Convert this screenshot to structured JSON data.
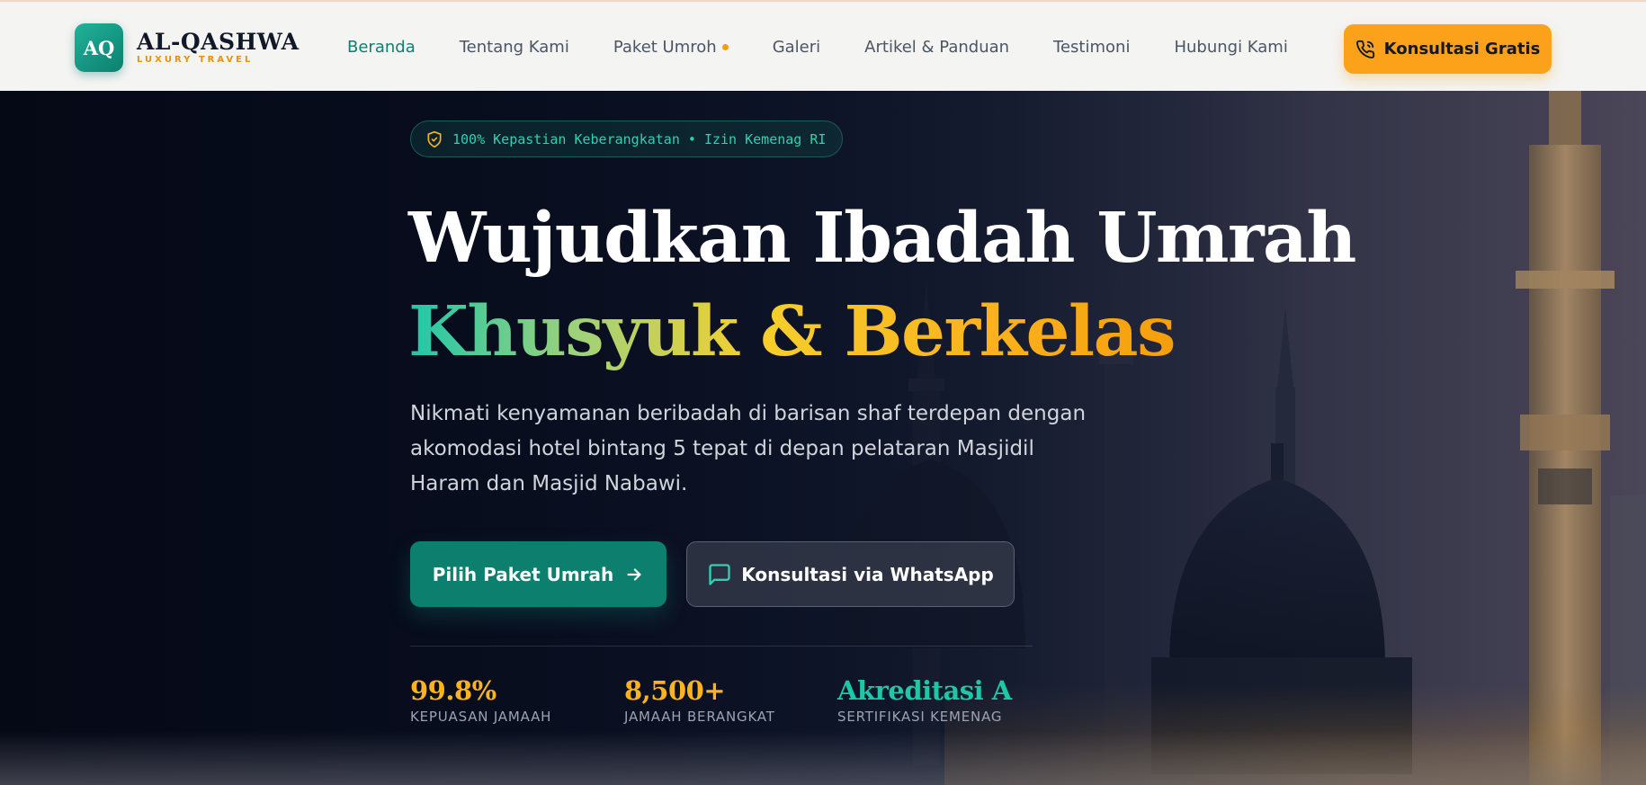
{
  "brand": {
    "badge": "AQ",
    "name": "AL-QASHWA",
    "tagline": "LUXURY TRAVEL"
  },
  "nav": {
    "items": [
      {
        "label": "Beranda",
        "active": true
      },
      {
        "label": "Tentang Kami"
      },
      {
        "label": "Paket Umroh",
        "indicator": true
      },
      {
        "label": "Galeri"
      },
      {
        "label": "Artikel & Panduan"
      },
      {
        "label": "Testimoni"
      },
      {
        "label": "Hubungi Kami"
      }
    ],
    "cta_label": "Konsultasi Gratis"
  },
  "hero": {
    "badge_text": "100% Kepastian Keberangkatan • Izin Kemenag RI",
    "headline_line1": "Wujudkan Ibadah Umrah",
    "headline_line2": "Khusyuk & Berkelas",
    "lead": "Nikmati kenyamanan beribadah di barisan shaf terdepan dengan akomodasi hotel bintang 5 tepat di depan pelataran Masjidil Haram dan Masjid Nabawi.",
    "primary_button": "Pilih Paket Umrah",
    "secondary_button": "Konsultasi via WhatsApp",
    "stats": [
      {
        "value": "99.8%",
        "label": "KEPUASAN JAMAAH",
        "color": "#fbb31e"
      },
      {
        "value": "8,500+",
        "label": "JAMAAH BERANGKAT",
        "color": "#fbb31e"
      },
      {
        "value": "Akreditasi A",
        "label": "SERTIFIKASI KEMENAG",
        "color": "#1fc7a8"
      }
    ]
  },
  "colors": {
    "primary": "#0d7f6f",
    "accent": "#fba21a",
    "teal_text": "#2fd1b4",
    "header_bg": "#f4f4f3"
  },
  "icons": {
    "cta": "phone-icon",
    "badge": "shield-check-icon",
    "primary_button": "arrow-right-icon",
    "secondary_button": "chat-icon"
  }
}
